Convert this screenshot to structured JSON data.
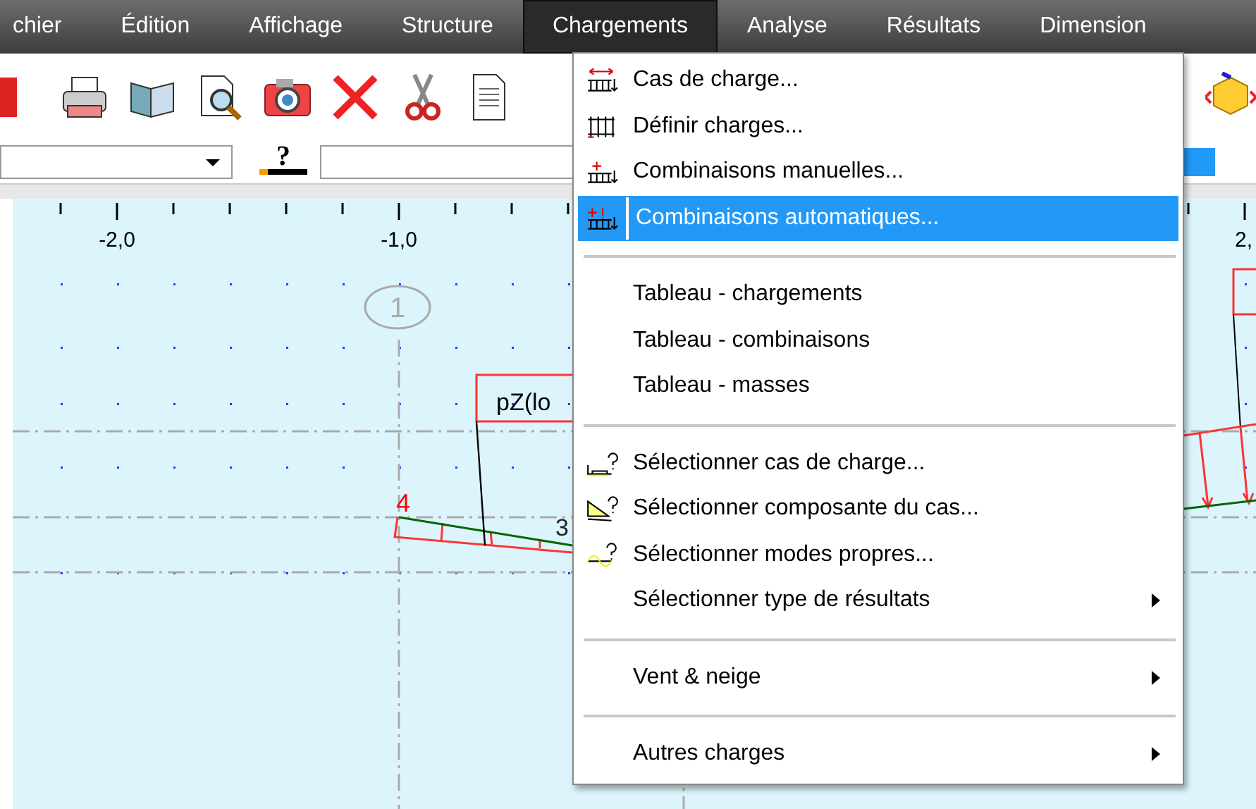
{
  "menu_bar": [
    {
      "label": "chier",
      "selected": false
    },
    {
      "label": "Édition",
      "selected": false
    },
    {
      "label": "Affichage",
      "selected": false
    },
    {
      "label": "Structure",
      "selected": false
    },
    {
      "label": "Chargements",
      "selected": true
    },
    {
      "label": "Analyse",
      "selected": false
    },
    {
      "label": "Résultats",
      "selected": false
    },
    {
      "label": "Dimension",
      "selected": false
    }
  ],
  "help_button": {
    "label": "?"
  },
  "canvas": {
    "ruler_labels": [
      "-2,0",
      "-1,0",
      "2,"
    ],
    "node_label": "1",
    "load_label": "pZ(lo",
    "node_numbers": [
      "4",
      "3"
    ]
  },
  "menu": {
    "items": [
      {
        "kind": "icon_item",
        "label": "Cas de charge...",
        "selected": false
      },
      {
        "kind": "icon_item",
        "label": "Définir charges...",
        "selected": false
      },
      {
        "kind": "icon_item",
        "label": "Combinaisons manuelles...",
        "selected": false
      },
      {
        "kind": "icon_item",
        "label": "Combinaisons automatiques...",
        "selected": true
      },
      {
        "kind": "separator"
      },
      {
        "kind": "item",
        "label": "Tableau - chargements",
        "selected": false
      },
      {
        "kind": "item",
        "label": "Tableau - combinaisons",
        "selected": false
      },
      {
        "kind": "item",
        "label": "Tableau - masses",
        "selected": false
      },
      {
        "kind": "separator"
      },
      {
        "kind": "icon_item",
        "label": "Sélectionner cas de charge...",
        "selected": false
      },
      {
        "kind": "icon_item",
        "label": "Sélectionner composante du cas...",
        "selected": false
      },
      {
        "kind": "icon_item",
        "label": "Sélectionner modes propres...",
        "selected": false
      },
      {
        "kind": "submenu_item",
        "label": "Sélectionner type de résultats",
        "selected": false
      },
      {
        "kind": "separator"
      },
      {
        "kind": "submenu_item",
        "label": "Vent & neige",
        "selected": false
      },
      {
        "kind": "separator"
      },
      {
        "kind": "submenu_item",
        "label": "Autres charges",
        "selected": false
      }
    ]
  }
}
